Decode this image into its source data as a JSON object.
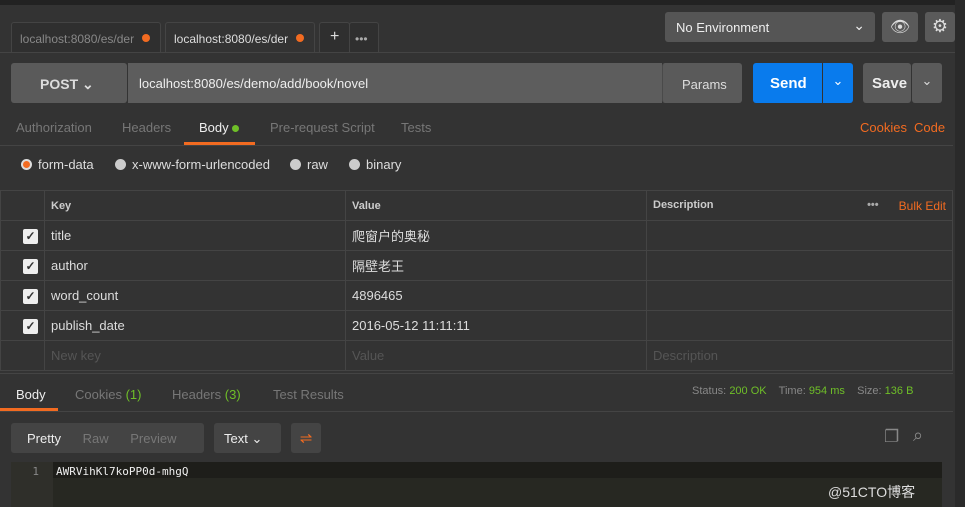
{
  "tabs": [
    {
      "label": "localhost:8080/es/der"
    },
    {
      "label": "localhost:8080/es/der"
    }
  ],
  "new_tab": "+",
  "more": "•••",
  "environment": "No Environment",
  "request": {
    "method": "POST",
    "url": "localhost:8080/es/demo/add/book/novel",
    "params": "Params",
    "send": "Send",
    "save": "Save"
  },
  "req_tabs": [
    "Authorization",
    "Headers",
    "Body",
    "Pre-request Script",
    "Tests"
  ],
  "links": {
    "cookies": "Cookies",
    "code": "Code"
  },
  "body_types": [
    "form-data",
    "x-www-form-urlencoded",
    "raw",
    "binary"
  ],
  "table": {
    "headers": [
      "Key",
      "Value",
      "Description"
    ],
    "bulk_edit": "Bulk Edit",
    "more": "•••",
    "rows": [
      {
        "key": "title",
        "value": "爬窗户的奥秘"
      },
      {
        "key": "author",
        "value": "隔壁老王"
      },
      {
        "key": "word_count",
        "value": "4896465"
      },
      {
        "key": "publish_date",
        "value": "2016-05-12 11:11:11"
      }
    ],
    "placeholders": {
      "key": "New key",
      "value": "Value",
      "description": "Description"
    }
  },
  "response": {
    "tabs": {
      "body": "Body",
      "cookies": "Cookies",
      "cookies_count": "(1)",
      "headers": "Headers",
      "headers_count": "(3)",
      "tests": "Test Results"
    },
    "status_label": "Status:",
    "status": "200 OK",
    "time_label": "Time:",
    "time": "954 ms",
    "size_label": "Size:",
    "size": "136 B",
    "views": [
      "Pretty",
      "Raw",
      "Preview"
    ],
    "format": "Text",
    "line": "1",
    "content": "AWRVihKl7koPP0d-mhgQ"
  },
  "watermark": "@51CTO博客"
}
